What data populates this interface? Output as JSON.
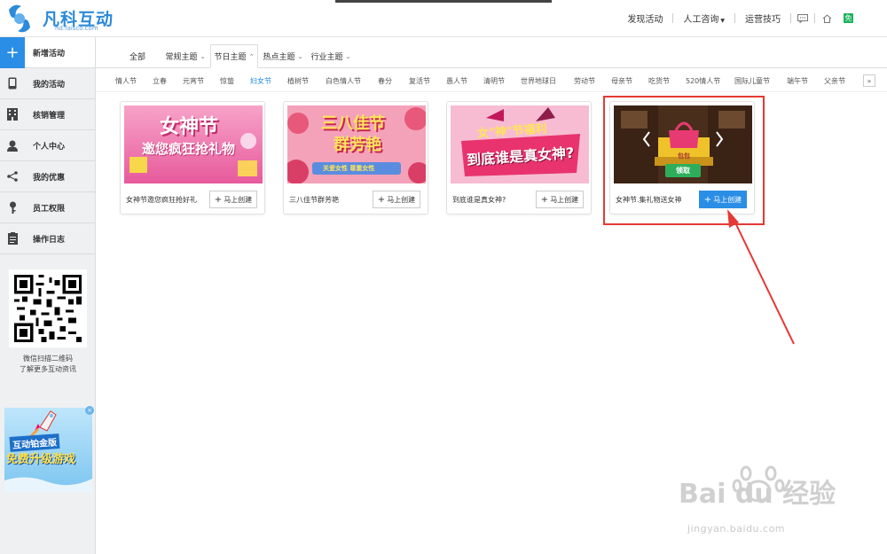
{
  "header": {
    "logo_text": "凡科互动",
    "logo_sub": "hd.faisco.com",
    "nav": [
      "发现活动",
      "人工咨询",
      "运营技巧"
    ],
    "badge": "免"
  },
  "sidebar": {
    "items": [
      {
        "label": "新增活动",
        "icon": "plus-icon"
      },
      {
        "label": "我的活动",
        "icon": "phone-icon"
      },
      {
        "label": "核销管理",
        "icon": "building-icon"
      },
      {
        "label": "个人中心",
        "icon": "user-icon"
      },
      {
        "label": "我的优惠",
        "icon": "share-icon"
      },
      {
        "label": "员工权限",
        "icon": "key-icon"
      },
      {
        "label": "操作日志",
        "icon": "clipboard-icon"
      }
    ],
    "qr_caption_1": "微信扫描二维码",
    "qr_caption_2": "了解更多互动资讯",
    "ad_title": "互动铂金版",
    "ad_main": "免费升级游戏"
  },
  "tabs": [
    "全部",
    "常规主题",
    "节日主题",
    "热点主题",
    "行业主题"
  ],
  "festivals": [
    "情人节",
    "立春",
    "元宵节",
    "惊蛰",
    "妇女节",
    "植树节",
    "白色情人节",
    "春分",
    "复活节",
    "愚人节",
    "清明节",
    "世界地球日",
    "劳动节",
    "母亲节",
    "吃货节",
    "520情人节",
    "国际儿童节",
    "端午节",
    "父亲节"
  ],
  "cards": [
    {
      "title": "女神节邀您疯狂抢好礼",
      "btn": "马上创建",
      "img_line1": "女神节",
      "img_line2": "邀您疯狂抢礼物"
    },
    {
      "title": "三八佳节群芳艳",
      "btn": "马上创建",
      "img_line1": "三八佳节",
      "img_line2": "群芳艳",
      "img_line3": "关爱女性 尊重女性"
    },
    {
      "title": "到底谁是真女神?",
      "btn": "马上创建",
      "img_line1": "女\"神\"节福利",
      "img_line2": "到底谁是真女神?"
    },
    {
      "title": "女神节.集礼物送女神",
      "btn": "马上创建",
      "img_bag": "包包",
      "img_btn": "领取"
    }
  ],
  "watermark": {
    "big": "Bai du 经验",
    "url": "jingyan.baidu.com"
  },
  "colors": {
    "accent": "#2a8ee6",
    "highlight": "#e53935"
  }
}
